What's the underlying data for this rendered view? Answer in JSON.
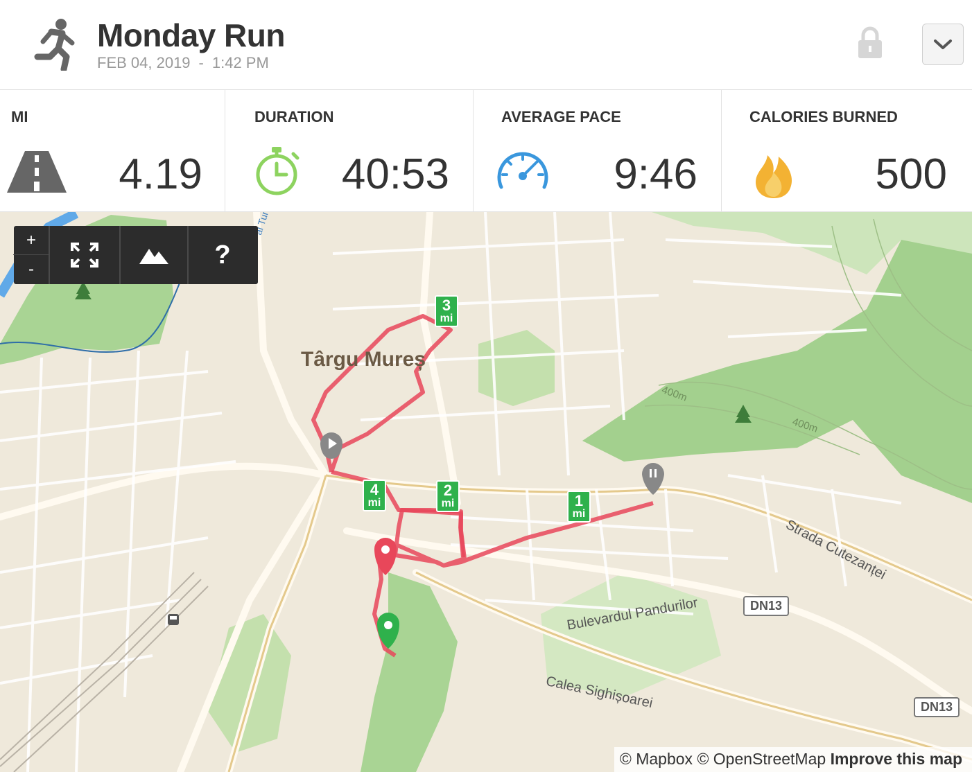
{
  "header": {
    "title": "Monday Run",
    "date": "FEB 04, 2019",
    "separator": "-",
    "time": "1:42 PM",
    "activity_icon": "running-person-icon",
    "lock_icon": "lock-icon",
    "dropdown_icon": "chevron-down-icon"
  },
  "stats": [
    {
      "label": "MI",
      "value": "4.19",
      "icon": "road-icon"
    },
    {
      "label": "DURATION",
      "value": "40:53",
      "icon": "stopwatch-icon"
    },
    {
      "label": "AVERAGE PACE",
      "value": "9:46",
      "icon": "speedometer-icon"
    },
    {
      "label": "CALORIES BURNED",
      "value": "500",
      "icon": "flame-icon"
    }
  ],
  "map_controls": {
    "zoom_in": "+",
    "zoom_out": "-",
    "fullscreen_icon": "fullscreen-icon",
    "terrain_icon": "mountain-icon",
    "help": "?"
  },
  "map_labels": {
    "city": "Târgu Mureș",
    "street1": "Strada Cutezanței",
    "street2": "Bulevardul Pandurilor",
    "street3": "Calea Sighișoarei",
    "elev1": "400m",
    "elev2": "400m",
    "road_shield": "DN13",
    "river_label": "al Turc"
  },
  "mile_markers": [
    {
      "n": "1",
      "unit": "mi"
    },
    {
      "n": "2",
      "unit": "mi"
    },
    {
      "n": "3",
      "unit": "mi"
    },
    {
      "n": "4",
      "unit": "mi"
    }
  ],
  "attribution": {
    "mapbox": "© Mapbox",
    "osm": "© OpenStreetMap",
    "improve": "Improve this map"
  },
  "colors": {
    "route": "#e8475a",
    "marker_green": "#2fb14c",
    "park_green": "#a9d494"
  }
}
